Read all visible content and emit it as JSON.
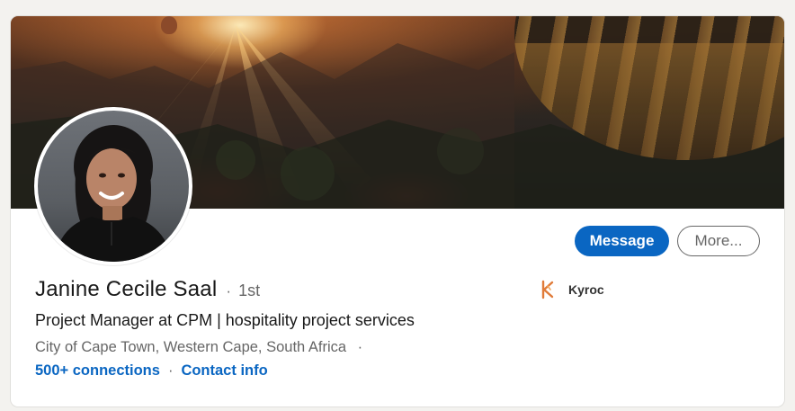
{
  "profile": {
    "name": "Janine Cecile Saal",
    "separator": "·",
    "degree": "1st",
    "headline": "Project Manager at CPM | hospitality project services",
    "location": "City of Cape Town, Western Cape, South Africa",
    "location_separator": "·",
    "connections": "500+ connections",
    "links_separator": "·",
    "contact_info": "Contact info"
  },
  "actions": {
    "message_label": "Message",
    "more_label": "More..."
  },
  "company": {
    "name": "Kyroc",
    "logo_icon": "kyroc-logo-icon",
    "logo_color": "#e07b39"
  },
  "colors": {
    "primary": "#0a66c2",
    "text": "#191919",
    "secondary_text": "#666666",
    "background": "#f3f2ef"
  }
}
